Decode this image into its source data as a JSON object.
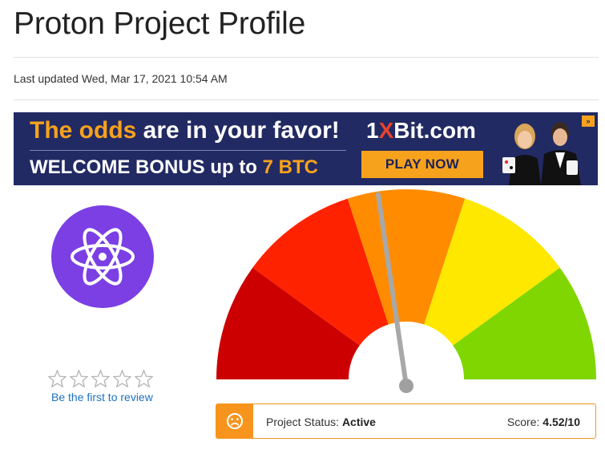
{
  "page": {
    "title": "Proton Project Profile",
    "last_updated": "Last updated Wed, Mar 17, 2021 10:54 AM"
  },
  "banner": {
    "headline_accent": "The odds",
    "headline_rest": " are in your favor!",
    "brand_a": "1",
    "brand_x": "X",
    "brand_b": "Bit.com",
    "bonus_text": "WELCOME BONUS up to ",
    "bonus_amount": "7 BTC",
    "cta": "PLAY NOW",
    "bg_color": "#222a63",
    "accent_color": "#f7a21c"
  },
  "project": {
    "logo_icon": "atom-icon",
    "logo_color": "#7b3fe4"
  },
  "rating": {
    "stars_filled": 0,
    "stars_total": 5,
    "review_link": "Be the first to review"
  },
  "gauge": {
    "score": 4.52,
    "max": 10,
    "segment_colors": [
      "#cc0000",
      "#ff2200",
      "#ff8c00",
      "#ffe800",
      "#7fd600"
    ]
  },
  "status_bar": {
    "status_label": "Project Status: ",
    "status_value": "Active",
    "score_label": "Score: ",
    "score_value": "4.52/10",
    "icon": "sad-face-icon",
    "accent_color": "#f7941d"
  }
}
